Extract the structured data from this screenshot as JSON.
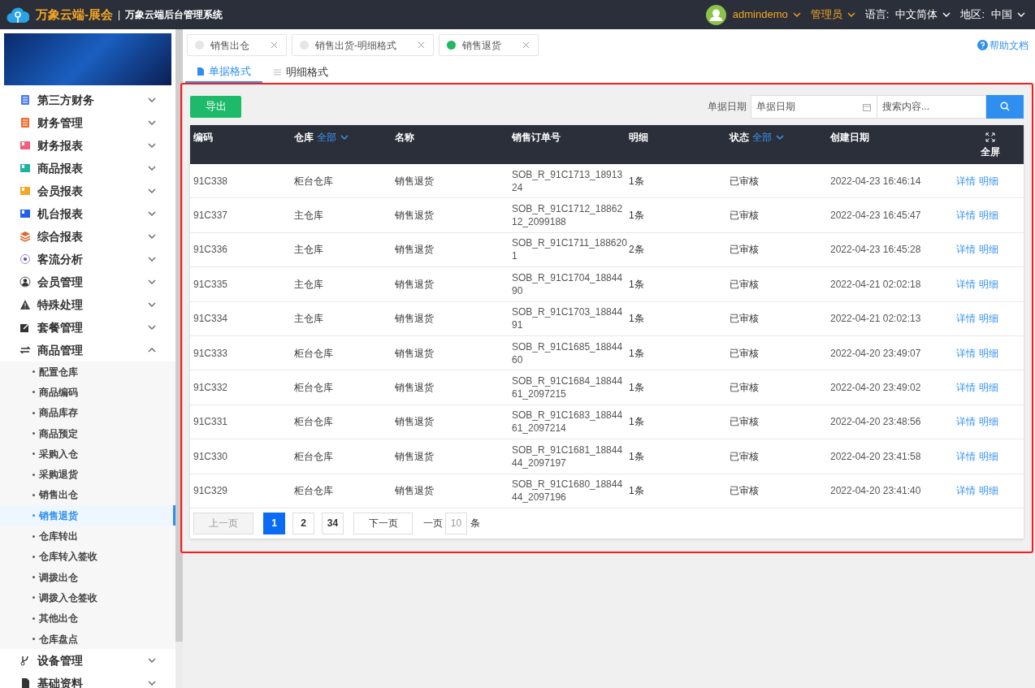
{
  "header": {
    "brand": "万象云端-展会",
    "separator": "|",
    "system_title": "万象云端后台管理系统",
    "user": "admindemo",
    "role": "管理员",
    "language_label": "语言:",
    "language": "中文简体",
    "region_label": "地区:",
    "region": "中国"
  },
  "sidebar": {
    "menu": [
      {
        "label": "第三方财务",
        "expanded": false
      },
      {
        "label": "财务管理",
        "expanded": false
      },
      {
        "label": "财务报表",
        "expanded": false
      },
      {
        "label": "商品报表",
        "expanded": false
      },
      {
        "label": "会员报表",
        "expanded": false
      },
      {
        "label": "机台报表",
        "expanded": false
      },
      {
        "label": "综合报表",
        "expanded": false
      },
      {
        "label": "客流分析",
        "expanded": false
      },
      {
        "label": "会员管理",
        "expanded": false
      },
      {
        "label": "特殊处理",
        "expanded": false
      },
      {
        "label": "套餐管理",
        "expanded": false
      },
      {
        "label": "商品管理",
        "expanded": true,
        "children": [
          {
            "label": "配置仓库",
            "selected": false
          },
          {
            "label": "商品编码",
            "selected": false
          },
          {
            "label": "商品库存",
            "selected": false
          },
          {
            "label": "商品预定",
            "selected": false
          },
          {
            "label": "采购入仓",
            "selected": false
          },
          {
            "label": "采购退货",
            "selected": false
          },
          {
            "label": "销售出仓",
            "selected": false
          },
          {
            "label": "销售退货",
            "selected": true
          },
          {
            "label": "仓库转出",
            "selected": false
          },
          {
            "label": "仓库转入签收",
            "selected": false
          },
          {
            "label": "调拨出仓",
            "selected": false
          },
          {
            "label": "调拨入仓签收",
            "selected": false
          },
          {
            "label": "其他出仓",
            "selected": false
          },
          {
            "label": "仓库盘点",
            "selected": false
          }
        ]
      },
      {
        "label": "设备管理",
        "expanded": false
      },
      {
        "label": "基础资料",
        "expanded": false
      }
    ]
  },
  "tabs": [
    {
      "label": "销售出仓",
      "selected": false
    },
    {
      "label": "销售出货-明细格式",
      "selected": false
    },
    {
      "label": "销售退货",
      "selected": true
    }
  ],
  "help_link": "帮助文档",
  "sub_tabs": [
    {
      "label": "单据格式",
      "selected": true
    },
    {
      "label": "明细格式",
      "selected": false
    }
  ],
  "toolbar": {
    "export_button": "导出",
    "date_label": "单据日期",
    "date_placeholder": "单据日期",
    "search_placeholder": "搜索内容..."
  },
  "table": {
    "columns": [
      {
        "label": "编码"
      },
      {
        "label": "仓库",
        "filter": "全部"
      },
      {
        "label": "名称"
      },
      {
        "label": "销售订单号"
      },
      {
        "label": "明细"
      },
      {
        "label": "状态",
        "filter": "全部"
      },
      {
        "label": "创建日期"
      },
      {
        "label": "全屏"
      }
    ],
    "rows": [
      {
        "code": "91C338",
        "warehouse": "柜台仓库",
        "name": "销售退货",
        "order_no": "SOB_R_91C1713_1891324",
        "detail": "1条",
        "status": "已审核",
        "created": "2022-04-23 16:46:14",
        "actions": [
          "详情",
          "明细"
        ]
      },
      {
        "code": "91C337",
        "warehouse": "主仓库",
        "name": "销售退货",
        "order_no": "SOB_R_91C1712_1886212_2099188",
        "detail": "1条",
        "status": "已审核",
        "created": "2022-04-23 16:45:47",
        "actions": [
          "详情",
          "明细"
        ]
      },
      {
        "code": "91C336",
        "warehouse": "主仓库",
        "name": "销售退货",
        "order_no": "SOB_R_91C1711_1886201",
        "detail": "2条",
        "status": "已审核",
        "created": "2022-04-23 16:45:28",
        "actions": [
          "详情",
          "明细"
        ]
      },
      {
        "code": "91C335",
        "warehouse": "主仓库",
        "name": "销售退货",
        "order_no": "SOB_R_91C1704_1884490",
        "detail": "1条",
        "status": "已审核",
        "created": "2022-04-21 02:02:18",
        "actions": [
          "详情",
          "明细"
        ]
      },
      {
        "code": "91C334",
        "warehouse": "主仓库",
        "name": "销售退货",
        "order_no": "SOB_R_91C1703_1884491",
        "detail": "1条",
        "status": "已审核",
        "created": "2022-04-21 02:02:13",
        "actions": [
          "详情",
          "明细"
        ]
      },
      {
        "code": "91C333",
        "warehouse": "柜台仓库",
        "name": "销售退货",
        "order_no": "SOB_R_91C1685_1884460",
        "detail": "1条",
        "status": "已审核",
        "created": "2022-04-20 23:49:07",
        "actions": [
          "详情",
          "明细"
        ]
      },
      {
        "code": "91C332",
        "warehouse": "柜台仓库",
        "name": "销售退货",
        "order_no": "SOB_R_91C1684_1884461_2097215",
        "detail": "1条",
        "status": "已审核",
        "created": "2022-04-20 23:49:02",
        "actions": [
          "详情",
          "明细"
        ]
      },
      {
        "code": "91C331",
        "warehouse": "柜台仓库",
        "name": "销售退货",
        "order_no": "SOB_R_91C1683_1884461_2097214",
        "detail": "1条",
        "status": "已审核",
        "created": "2022-04-20 23:48:56",
        "actions": [
          "详情",
          "明细"
        ]
      },
      {
        "code": "91C330",
        "warehouse": "柜台仓库",
        "name": "销售退货",
        "order_no": "SOB_R_91C1681_1884444_2097197",
        "detail": "1条",
        "status": "已审核",
        "created": "2022-04-20 23:41:58",
        "actions": [
          "详情",
          "明细"
        ]
      },
      {
        "code": "91C329",
        "warehouse": "柜台仓库",
        "name": "销售退货",
        "order_no": "SOB_R_91C1680_1884444_2097196",
        "detail": "1条",
        "status": "已审核",
        "created": "2022-04-20 23:41:40",
        "actions": [
          "详情",
          "明细"
        ]
      }
    ]
  },
  "pagination": {
    "prev": {
      "label": "上一页",
      "disabled": true
    },
    "pages": [
      {
        "label": "1",
        "selected": true
      },
      {
        "label": "2",
        "selected": false
      },
      {
        "label": "34",
        "selected": false
      }
    ],
    "next": {
      "label": "下一页",
      "disabled": false
    },
    "per_page_label": "一页",
    "per_page": "10",
    "unit": "条"
  }
}
